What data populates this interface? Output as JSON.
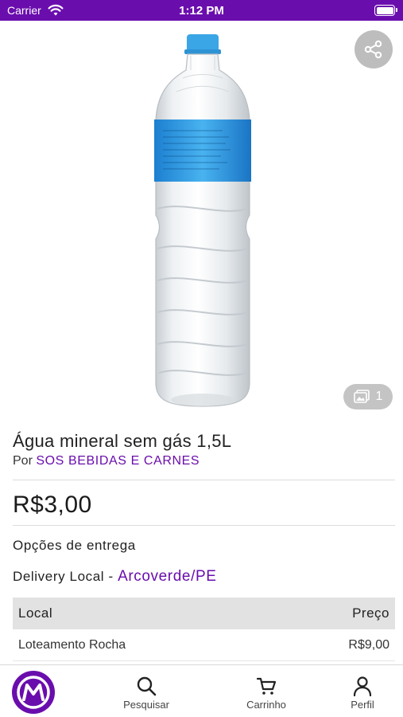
{
  "status_bar": {
    "carrier": "Carrier",
    "time": "1:12 PM"
  },
  "product": {
    "title": "Água mineral sem gás 1,5L",
    "seller_prefix": "Por",
    "seller_name": "SOS BEBIDAS E CARNES",
    "price": "R$3,00",
    "image_count": "1"
  },
  "delivery": {
    "options_label": "Opções de entrega",
    "type_label": "Delivery Local - ",
    "city": "Arcoverde/PE",
    "table": {
      "headers": [
        "Local",
        "Preço"
      ],
      "rows": [
        {
          "local": "Loteamento Rocha",
          "price": "R$9,00"
        }
      ]
    }
  },
  "tab_bar": {
    "items": [
      {
        "label": "Pesquisar",
        "icon": "search-icon"
      },
      {
        "label": "Carrinho",
        "icon": "cart-icon"
      },
      {
        "label": "Perfil",
        "icon": "user-icon"
      }
    ]
  },
  "colors": {
    "brand": "#6a0dad",
    "badge_gray": "#c4c4c4"
  }
}
